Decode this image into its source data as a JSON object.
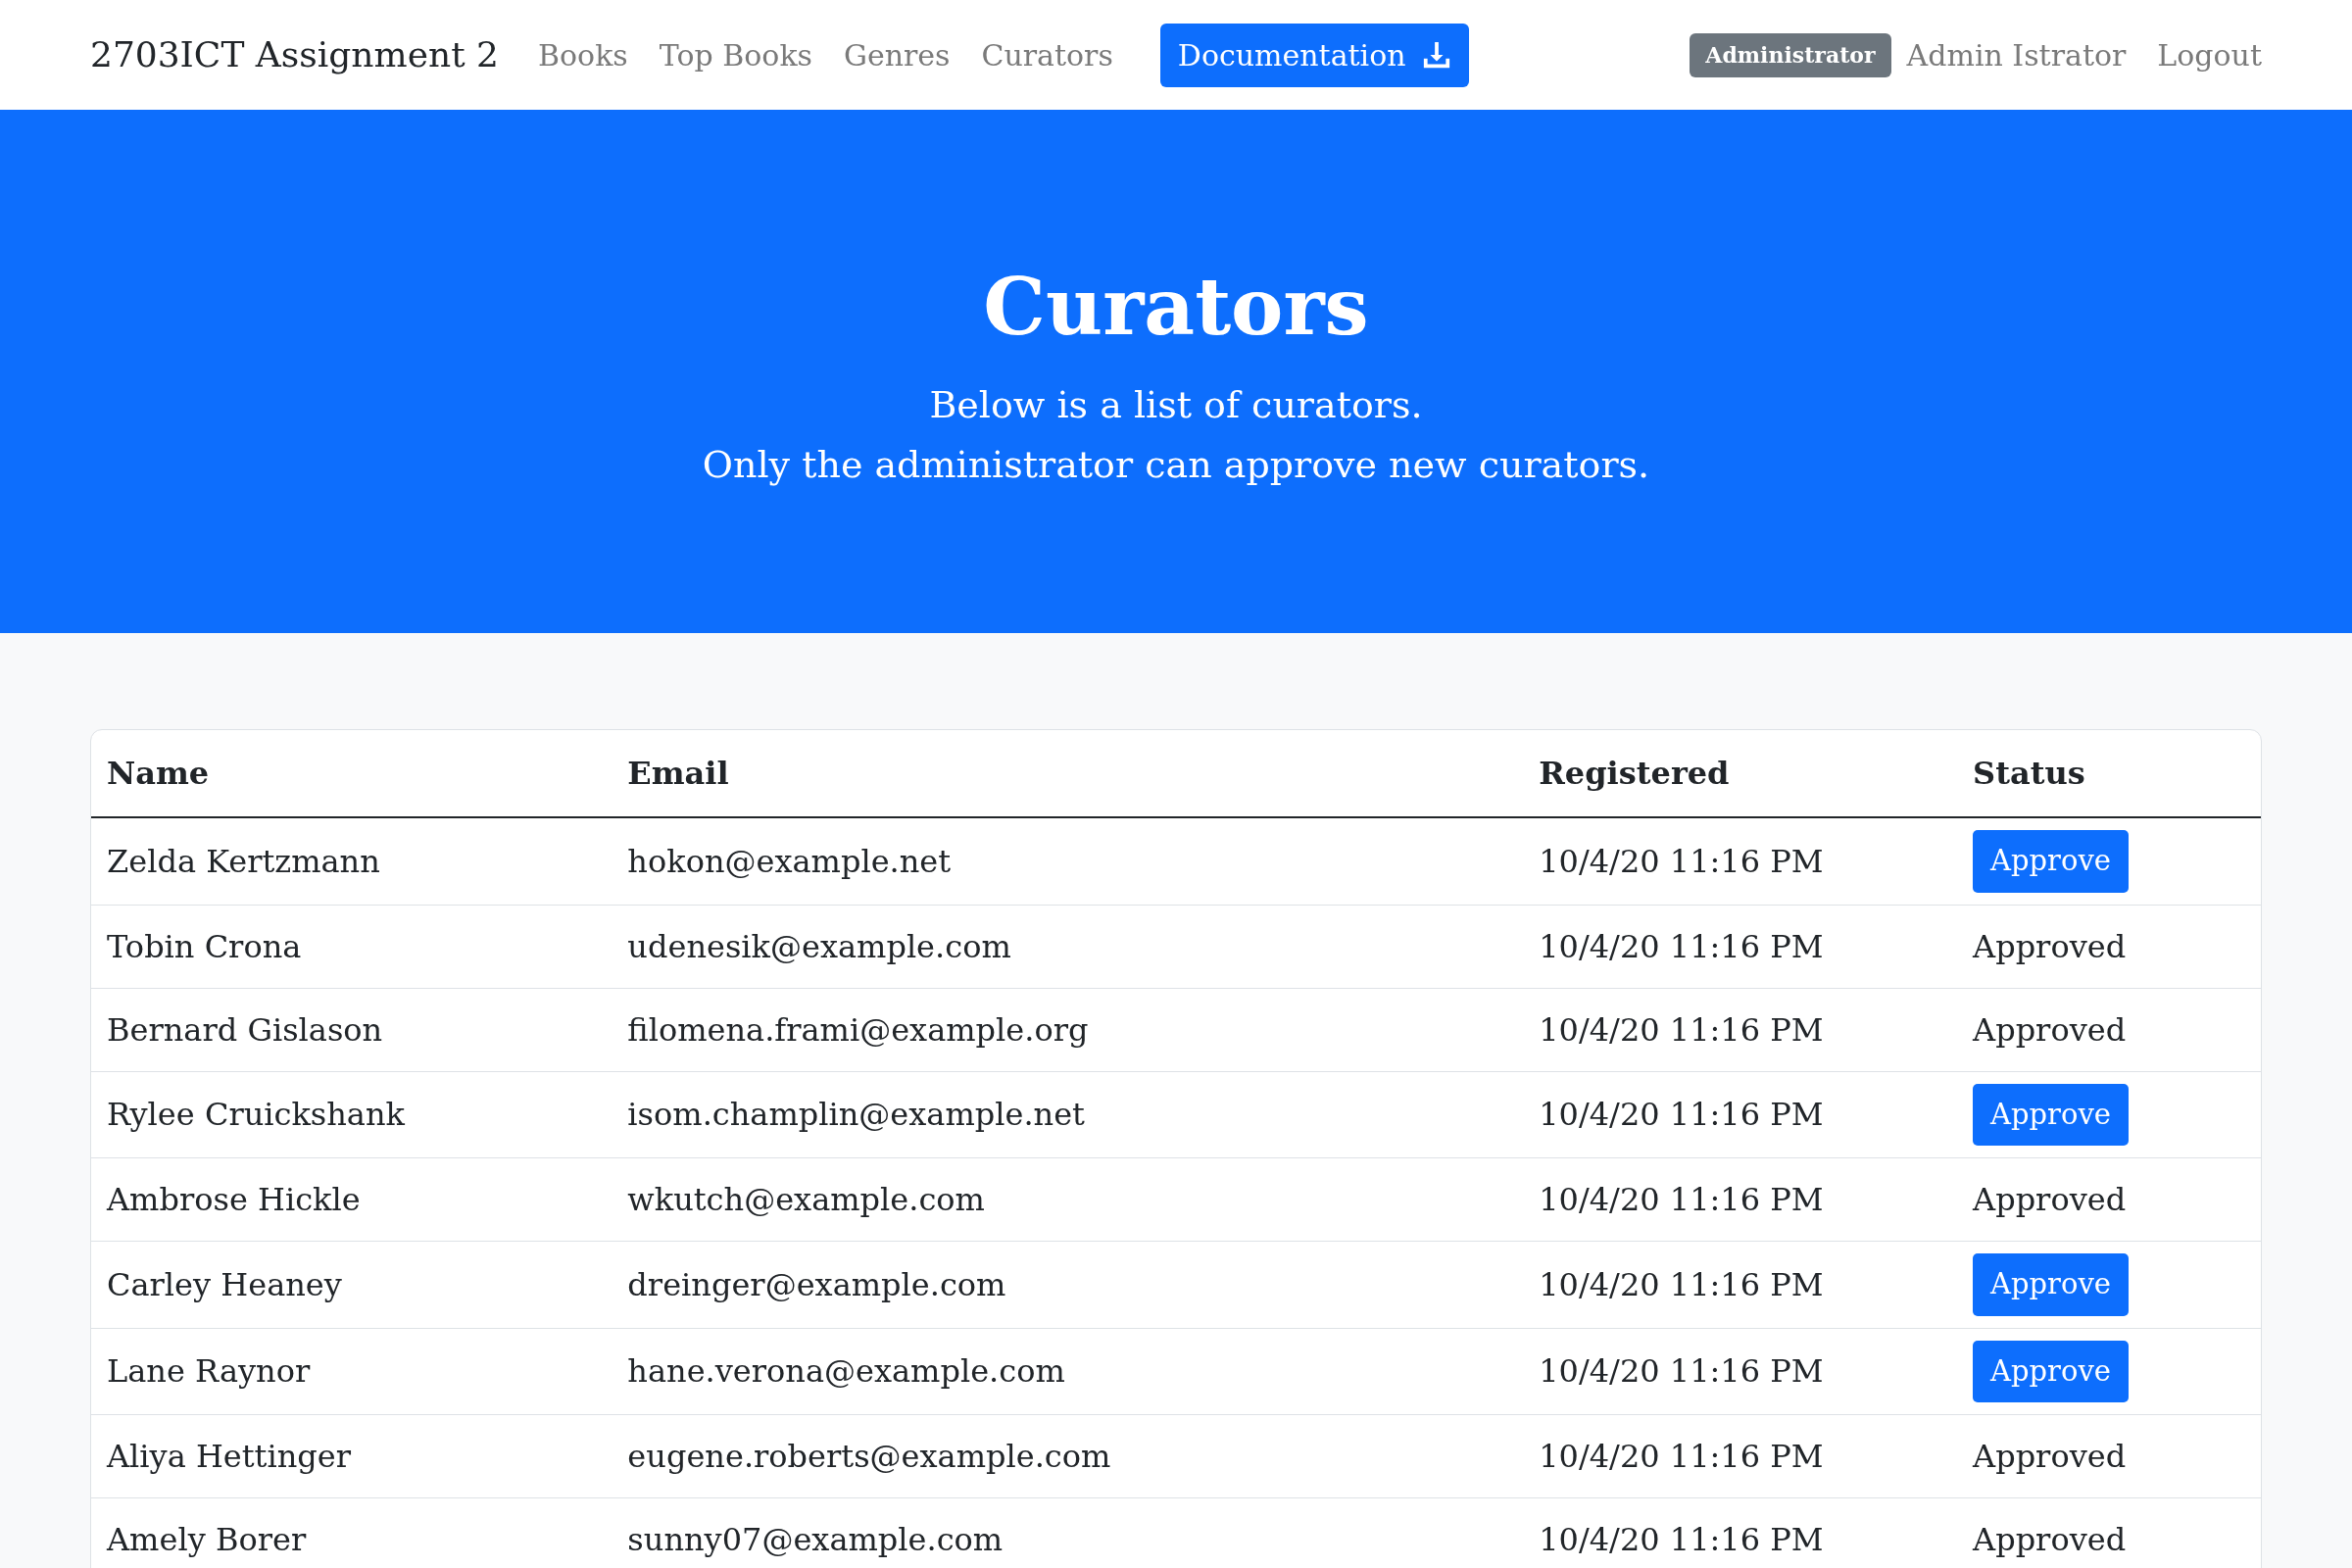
{
  "navbar": {
    "brand": "2703ICT Assignment 2",
    "links": [
      {
        "label": "Books",
        "selected": false
      },
      {
        "label": "Top Books",
        "selected": false
      },
      {
        "label": "Genres",
        "selected": false
      },
      {
        "label": "Curators",
        "selected": false
      }
    ],
    "doc_button": "Documentation",
    "role_badge": "Administrator",
    "user": "Admin Istrator",
    "logout": "Logout"
  },
  "hero": {
    "title": "Curators",
    "lines": [
      "Below is a list of curators.",
      "Only the administrator can approve new curators."
    ]
  },
  "table": {
    "columns": [
      "Name",
      "Email",
      "Registered",
      "Status"
    ],
    "rows": [
      {
        "name": "Zelda Kertzmann",
        "email": "hokon@example.net",
        "registered": "10/4/20 11:16 PM",
        "status": {
          "kind": "button",
          "label": "Approve"
        }
      },
      {
        "name": "Tobin Crona",
        "email": "udenesik@example.com",
        "registered": "10/4/20 11:16 PM",
        "status": {
          "kind": "text",
          "label": "Approved"
        }
      },
      {
        "name": "Bernard Gislason",
        "email": "filomena.frami@example.org",
        "registered": "10/4/20 11:16 PM",
        "status": {
          "kind": "text",
          "label": "Approved"
        }
      },
      {
        "name": "Rylee Cruickshank",
        "email": "isom.champlin@example.net",
        "registered": "10/4/20 11:16 PM",
        "status": {
          "kind": "button",
          "label": "Approve"
        }
      },
      {
        "name": "Ambrose Hickle",
        "email": "wkutch@example.com",
        "registered": "10/4/20 11:16 PM",
        "status": {
          "kind": "text",
          "label": "Approved"
        }
      },
      {
        "name": "Carley Heaney",
        "email": "dreinger@example.com",
        "registered": "10/4/20 11:16 PM",
        "status": {
          "kind": "button",
          "label": "Approve"
        }
      },
      {
        "name": "Lane Raynor",
        "email": "hane.verona@example.com",
        "registered": "10/4/20 11:16 PM",
        "status": {
          "kind": "button",
          "label": "Approve"
        }
      },
      {
        "name": "Aliya Hettinger",
        "email": "eugene.roberts@example.com",
        "registered": "10/4/20 11:16 PM",
        "status": {
          "kind": "text",
          "label": "Approved"
        }
      },
      {
        "name": "Amely Borer",
        "email": "sunny07@example.com",
        "registered": "10/4/20 11:16 PM",
        "status": {
          "kind": "text",
          "label": "Approved"
        }
      }
    ]
  }
}
